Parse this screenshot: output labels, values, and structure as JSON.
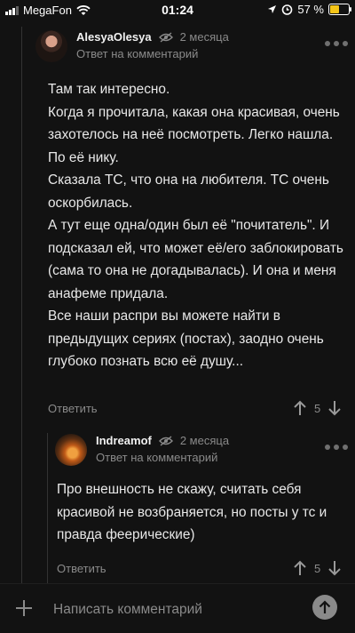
{
  "status_bar": {
    "carrier": "MegaFon",
    "time": "01:24",
    "battery_percent": "57 %",
    "battery_level": 0.57,
    "icons": [
      "signal-icon",
      "wifi-icon",
      "location-icon",
      "alarm-icon",
      "battery-icon"
    ]
  },
  "comments": [
    {
      "author": "AlesyaOlesya",
      "time": "2 месяца",
      "reply_to": "Ответ на комментарий",
      "paragraphs": [
        "Там так интересно.",
        "Когда я прочитала, какая она красивая, очень захотелось на неё посмотреть. Легко нашла. По её нику.",
        "Сказала ТС, что она на любителя. ТС очень оскорбилась.",
        "А тут еще одна/один был её \"почитатель\". И подсказал ей, что может её/его заблокировать (сама то она не догадывалась). И она и меня анафеме придала.",
        "Все наши распри вы можете найти в предыдущих сериях (постах), заодно очень глубоко познать всю её душу..."
      ],
      "reply_label": "Ответить",
      "votes": "5"
    },
    {
      "author": "Indreamof",
      "time": "2 месяца",
      "reply_to": "Ответ на комментарий",
      "paragraphs": [
        "Про внешность не скажу, считать себя красивой не возбраняется, но посты у тс и правда феерические)"
      ],
      "reply_label": "Ответить",
      "votes": "5"
    }
  ],
  "composer": {
    "placeholder": "Написать комментарий"
  },
  "colors": {
    "background": "#121212",
    "text": "#e6e6e6",
    "muted": "#8a8a8a",
    "battery": "#f5c518"
  }
}
